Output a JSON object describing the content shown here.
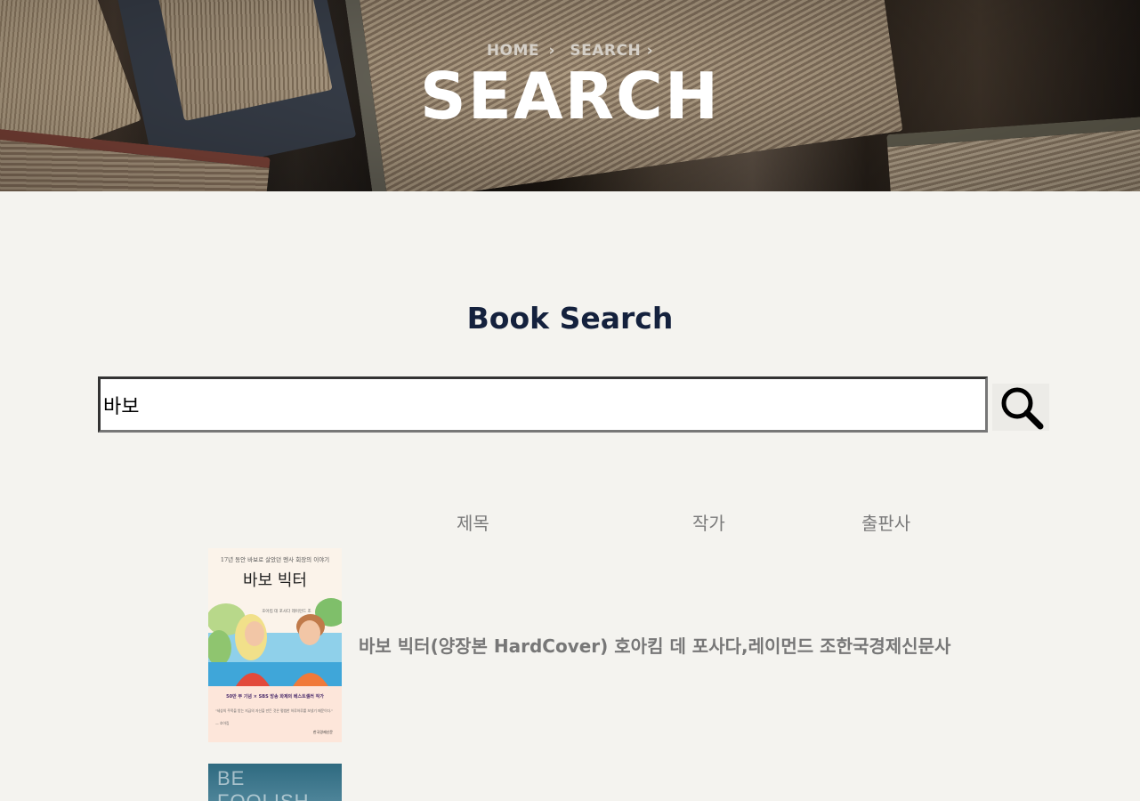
{
  "hero": {
    "breadcrumb": [
      {
        "label": "HOME",
        "sep": "›"
      },
      {
        "label": "SEARCH",
        "sep": "›"
      }
    ],
    "title": "SEARCH"
  },
  "search": {
    "heading": "Book Search",
    "value": "바보",
    "button_icon": "search-icon"
  },
  "table": {
    "headers": {
      "title": "제목",
      "author": "작가",
      "publisher": "출판사"
    },
    "rows": [
      {
        "title": "바보 빅터(양장본 HardCover)",
        "author": "호아킴 데 포사다,레이먼드 조",
        "publisher": "한국경제신문사",
        "cover": {
          "top_line": "17년 동안 바보로 살았던 멘사 회장의 이야기",
          "title": "바보 빅터",
          "authors": "호아킴 데 포사다\n레이먼드 조",
          "tagline": "50만 부 기념 × SBS 방송 화제의 베스트셀러 작가",
          "quote": "\"세상의 주목을 받는 지금의 자신을 만든 것은 평범한 하루하루를 보냈기 때문이다.\"",
          "quote_author": "— 호아킴",
          "publisher_mark": "한국경제신문"
        }
      },
      {
        "cover_text": "BE FOOLISH"
      }
    ]
  },
  "colors": {
    "background": "#f4f3ef",
    "heading": "#14213d",
    "muted_text": "#777777"
  }
}
